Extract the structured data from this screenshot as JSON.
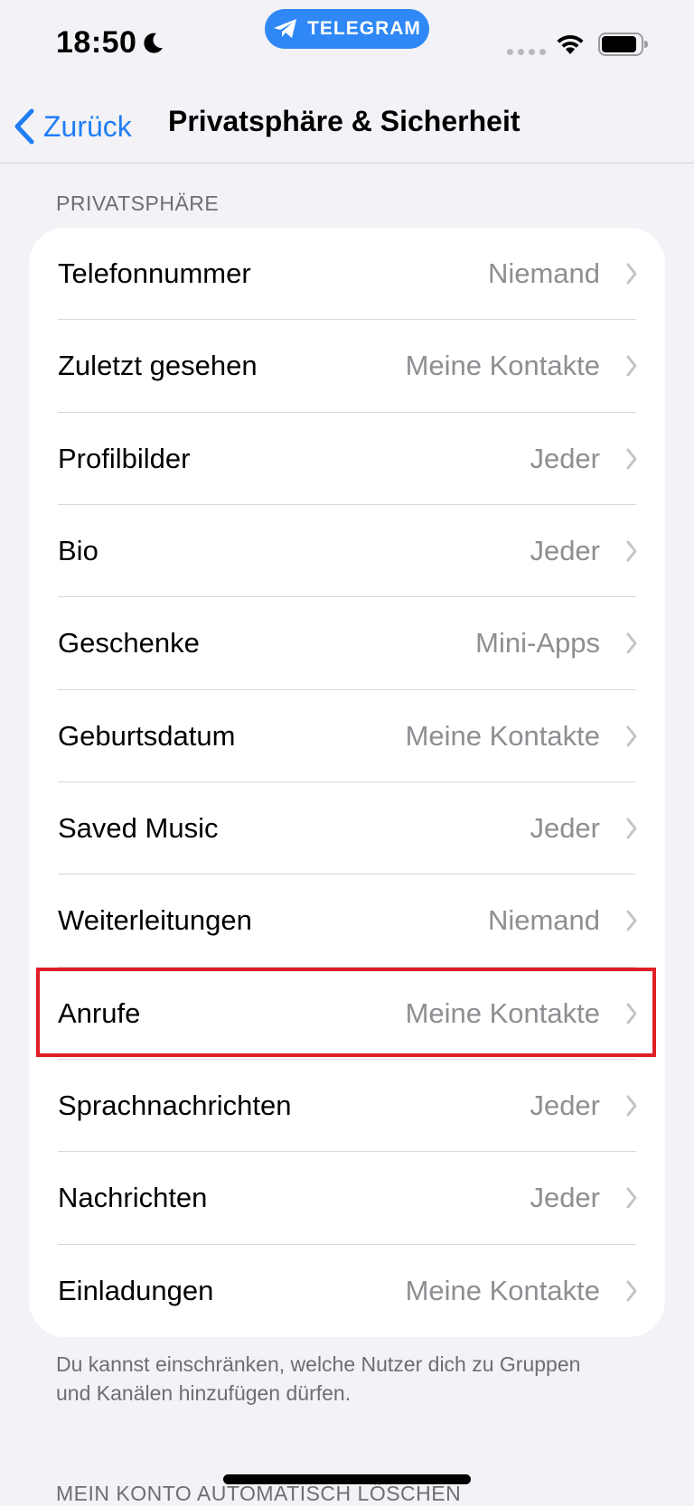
{
  "status_bar": {
    "time": "18:50",
    "pill_label": "TELEGRAM"
  },
  "nav": {
    "back_label": "Zurück",
    "title": "Privatsphäre & Sicherheit"
  },
  "privacy_section": {
    "header": "PRIVATSPHÄRE",
    "items": [
      {
        "label": "Telefonnummer",
        "value": "Niemand"
      },
      {
        "label": "Zuletzt gesehen",
        "value": "Meine Kontakte"
      },
      {
        "label": "Profilbilder",
        "value": "Jeder"
      },
      {
        "label": "Bio",
        "value": "Jeder"
      },
      {
        "label": "Geschenke",
        "value": "Mini-Apps"
      },
      {
        "label": "Geburtsdatum",
        "value": "Meine Kontakte"
      },
      {
        "label": "Saved Music",
        "value": "Jeder"
      },
      {
        "label": "Weiterleitungen",
        "value": "Niemand"
      },
      {
        "label": "Anrufe",
        "value": "Meine Kontakte"
      },
      {
        "label": "Sprachnachrichten",
        "value": "Jeder"
      },
      {
        "label": "Nachrichten",
        "value": "Jeder"
      },
      {
        "label": "Einladungen",
        "value": "Meine Kontakte"
      }
    ],
    "footnote": "Du kannst einschränken, welche Nutzer dich zu Gruppen und Kanälen hinzufügen dürfen."
  },
  "next_section": {
    "header": "MEIN KONTO AUTOMATISCH LÖSCHEN"
  },
  "colors": {
    "accent": "#1f7ef5",
    "telegram_pill": "#2f88f5",
    "highlight": "#e01e25",
    "secondary_text": "#8e8e93",
    "background": "#f2f2f7"
  }
}
